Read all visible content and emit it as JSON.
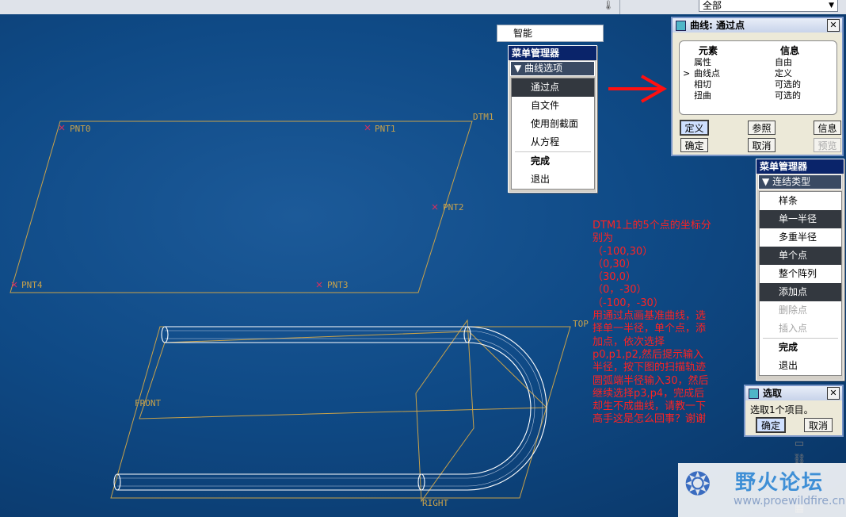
{
  "topbar": {
    "filter_value": "全部"
  },
  "smart_filter": {
    "label": "智能"
  },
  "menu1": {
    "title": "菜单管理器",
    "submenu": "曲线选项",
    "items": [
      "通过点",
      "自文件",
      "使用剖截面",
      "从方程",
      "完成",
      "退出"
    ],
    "selected_index": 0
  },
  "curve_dialog": {
    "title": "曲线: 通过点",
    "col_element": "元素",
    "col_info": "信息",
    "rows": [
      {
        "element": "属性",
        "info": "自由"
      },
      {
        "element": "曲线点",
        "info": "定义"
      },
      {
        "element": "相切",
        "info": "可选的"
      },
      {
        "element": "扭曲",
        "info": "可选的"
      }
    ],
    "current_row_marker": ">",
    "buttons": {
      "define": "定义",
      "reference": "参照",
      "info": "信息",
      "ok": "确定",
      "cancel": "取消",
      "preview": "预览"
    }
  },
  "menu2": {
    "title": "菜单管理器",
    "submenu": "连结类型",
    "items": [
      "样条",
      "单一半径",
      "多重半径",
      "单个点",
      "整个阵列",
      "添加点",
      "删除点",
      "插入点",
      "完成",
      "退出"
    ],
    "selected_indices": [
      1,
      3,
      5
    ],
    "disabled_indices": [
      6,
      7
    ]
  },
  "pick_dialog": {
    "title": "选取",
    "message": "选取1个项目。",
    "ok": "确定",
    "cancel": "取消"
  },
  "scene_labels": {
    "pnt0": "PNT0",
    "pnt1": "PNT1",
    "pnt2": "PNT2",
    "pnt3": "PNT3",
    "pnt4": "PNT4",
    "dtm1": "DTM1",
    "top": "TOP",
    "front": "FRONT",
    "right": "RIGHT"
  },
  "annotation": "DTM1上的5个点的坐标分\n别为\n（-100,30）\n（0,30）\n（30,0）\n（0，-30）\n（-100，-30）\n用通过点画基准曲线，选\n择单一半径，单个点，添\n加点，依次选择\np0,p1,p2,然后提示输入\n半径，按下图的扫描轨迹\n圆弧端半径输入30，然后\n继续选择p3,p4，完成后\n却生不成曲线，请教一下\n高手这是怎么回事？谢谢",
  "watermark": {
    "cn": "野火论坛",
    "url": "www.proewildfire.cn"
  },
  "colors": {
    "viewport_bg": "#0f4a86",
    "datum_plane": "#c9a24a",
    "point_marker": "#d03060",
    "annotation": "#ff2222",
    "arrow": "#ff1010"
  },
  "icons": [
    "thermometer-icon",
    "arrow-right-icon",
    "ruler-icon",
    "chain-icon",
    "tool-icon",
    "grid-icon"
  ]
}
